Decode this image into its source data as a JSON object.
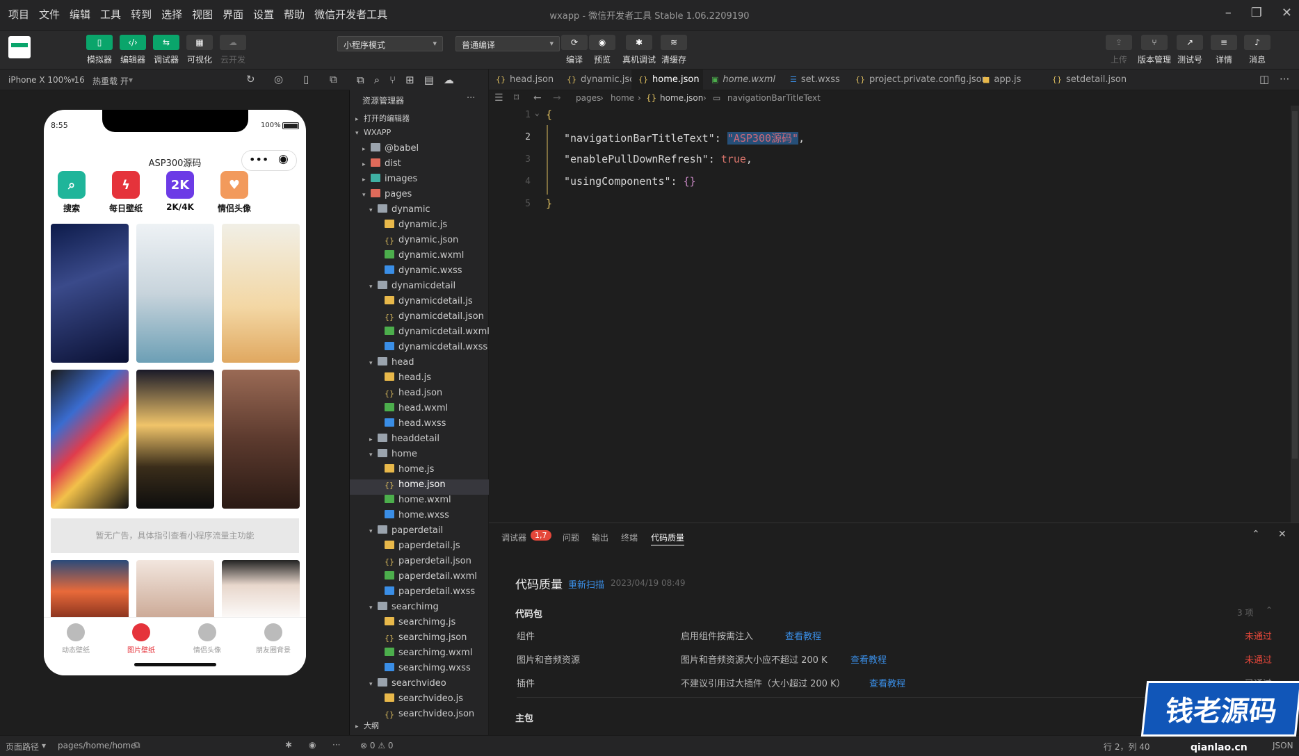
{
  "menu": [
    "项目",
    "文件",
    "编辑",
    "工具",
    "转到",
    "选择",
    "视图",
    "界面",
    "设置",
    "帮助",
    "微信开发者工具"
  ],
  "window_title": "wxapp - 微信开发者工具 Stable 1.06.2209190",
  "toolbar": {
    "left_buttons": [
      "模拟器",
      "编辑器",
      "调试器",
      "可视化",
      "云开发"
    ],
    "mode_select": "小程序模式",
    "compile_select": "普通编译",
    "center_buttons": [
      "编译",
      "预览",
      "真机调试",
      "清缓存"
    ],
    "right_buttons": [
      "上传",
      "版本管理",
      "测试号",
      "详情",
      "消息"
    ]
  },
  "simulator": {
    "device": "iPhone X 100% 16",
    "hot_reload": "热重载 开",
    "status_time": "8:55",
    "battery": "100%",
    "nav_title": "ASP300源码",
    "categories": [
      {
        "label": "搜索",
        "color": "#1fb59a"
      },
      {
        "label": "每日壁纸",
        "color": "#e5333b"
      },
      {
        "label": "2K/4K",
        "color": "#6c3be6"
      },
      {
        "label": "情侣头像",
        "color": "#f29a5c"
      }
    ],
    "ad_text": "暂无广告，具体指引查看小程序流量主功能",
    "tabs": [
      "动态壁纸",
      "图片壁纸",
      "情侣头像",
      "朋友圈背景"
    ],
    "active_tab": "图片壁纸"
  },
  "explorer": {
    "title": "资源管理器",
    "open_editors": "打开的编辑器",
    "root": "WXAPP",
    "items": [
      {
        "label": "@babel",
        "depth": 1,
        "type": "folder",
        "open": false
      },
      {
        "label": "dist",
        "depth": 1,
        "type": "folder-red",
        "open": false
      },
      {
        "label": "images",
        "depth": 1,
        "type": "folder-teal",
        "open": false
      },
      {
        "label": "pages",
        "depth": 1,
        "type": "folder-red",
        "open": true
      },
      {
        "label": "dynamic",
        "depth": 2,
        "type": "folder",
        "open": true
      },
      {
        "label": "dynamic.js",
        "depth": 3,
        "type": "js"
      },
      {
        "label": "dynamic.json",
        "depth": 3,
        "type": "json"
      },
      {
        "label": "dynamic.wxml",
        "depth": 3,
        "type": "wxml"
      },
      {
        "label": "dynamic.wxss",
        "depth": 3,
        "type": "wxss"
      },
      {
        "label": "dynamicdetail",
        "depth": 2,
        "type": "folder",
        "open": true
      },
      {
        "label": "dynamicdetail.js",
        "depth": 3,
        "type": "js"
      },
      {
        "label": "dynamicdetail.json",
        "depth": 3,
        "type": "json"
      },
      {
        "label": "dynamicdetail.wxml",
        "depth": 3,
        "type": "wxml"
      },
      {
        "label": "dynamicdetail.wxss",
        "depth": 3,
        "type": "wxss"
      },
      {
        "label": "head",
        "depth": 2,
        "type": "folder",
        "open": true
      },
      {
        "label": "head.js",
        "depth": 3,
        "type": "js"
      },
      {
        "label": "head.json",
        "depth": 3,
        "type": "json"
      },
      {
        "label": "head.wxml",
        "depth": 3,
        "type": "wxml"
      },
      {
        "label": "head.wxss",
        "depth": 3,
        "type": "wxss"
      },
      {
        "label": "headdetail",
        "depth": 2,
        "type": "folder",
        "open": false
      },
      {
        "label": "home",
        "depth": 2,
        "type": "folder",
        "open": true
      },
      {
        "label": "home.js",
        "depth": 3,
        "type": "js"
      },
      {
        "label": "home.json",
        "depth": 3,
        "type": "json",
        "selected": true
      },
      {
        "label": "home.wxml",
        "depth": 3,
        "type": "wxml"
      },
      {
        "label": "home.wxss",
        "depth": 3,
        "type": "wxss"
      },
      {
        "label": "paperdetail",
        "depth": 2,
        "type": "folder",
        "open": true
      },
      {
        "label": "paperdetail.js",
        "depth": 3,
        "type": "js"
      },
      {
        "label": "paperdetail.json",
        "depth": 3,
        "type": "json"
      },
      {
        "label": "paperdetail.wxml",
        "depth": 3,
        "type": "wxml"
      },
      {
        "label": "paperdetail.wxss",
        "depth": 3,
        "type": "wxss"
      },
      {
        "label": "searchimg",
        "depth": 2,
        "type": "folder",
        "open": true
      },
      {
        "label": "searchimg.js",
        "depth": 3,
        "type": "js"
      },
      {
        "label": "searchimg.json",
        "depth": 3,
        "type": "json"
      },
      {
        "label": "searchimg.wxml",
        "depth": 3,
        "type": "wxml"
      },
      {
        "label": "searchimg.wxss",
        "depth": 3,
        "type": "wxss"
      },
      {
        "label": "searchvideo",
        "depth": 2,
        "type": "folder",
        "open": true
      },
      {
        "label": "searchvideo.js",
        "depth": 3,
        "type": "js"
      },
      {
        "label": "searchvideo.json",
        "depth": 3,
        "type": "json"
      }
    ],
    "outline": "大纲"
  },
  "editor_tabs": [
    {
      "label": "head.json",
      "type": "json"
    },
    {
      "label": "dynamic.json",
      "type": "json"
    },
    {
      "label": "home.json",
      "type": "json",
      "active": true
    },
    {
      "label": "home.wxml",
      "type": "wxml"
    },
    {
      "label": "set.wxss",
      "type": "wxss"
    },
    {
      "label": "project.private.config.json",
      "type": "json"
    },
    {
      "label": "app.js",
      "type": "js"
    },
    {
      "label": "setdetail.json",
      "type": "json"
    }
  ],
  "breadcrumb": [
    "pages",
    "home",
    "home.json",
    "navigationBarTitleText"
  ],
  "code": {
    "line_numbers": [
      "1",
      "2",
      "3",
      "4",
      "5"
    ],
    "k1": "\"navigationBarTitleText\"",
    "v1": "\"ASP300源码\"",
    "k2": "\"enablePullDownRefresh\"",
    "v2": "true",
    "k3": "\"usingComponents\"",
    "v3": "{}"
  },
  "panel": {
    "tabs": [
      "调试器",
      "问题",
      "输出",
      "终端",
      "代码质量"
    ],
    "badge": "1,7",
    "active_tab": "代码质量",
    "title": "代码质量",
    "rescan": "重新扫描",
    "scan_time": "2023/04/19 08:49",
    "section": "代码包",
    "section_count": "3 项",
    "rows": [
      {
        "name": "组件",
        "desc": "启用组件按需注入",
        "link": "查看教程",
        "status": "未通过",
        "fail": true
      },
      {
        "name": "图片和音频资源",
        "desc": "图片和音频资源大小应不超过 200 K",
        "link": "查看教程",
        "status": "未通过",
        "fail": true
      },
      {
        "name": "插件",
        "desc": "不建议引用过大插件（大小超过 200 K）",
        "link": "查看教程",
        "status": "已通过",
        "fail": false
      }
    ],
    "main_package": "主包"
  },
  "statusbar": {
    "page_path_label": "页面路径",
    "page_path": "pages/home/home",
    "errors": "⊗ 0 ⚠ 0",
    "cursor": "行 2，列 40",
    "lang": "JSON"
  },
  "watermark": {
    "text": "钱老源码",
    "url": "qianlao.cn"
  },
  "colors": {
    "accent": "#0aa56b",
    "link": "#3a8ee6",
    "fail": "#e5473a",
    "badge": "#e5473a",
    "active_tab_red": "#e5333b"
  }
}
